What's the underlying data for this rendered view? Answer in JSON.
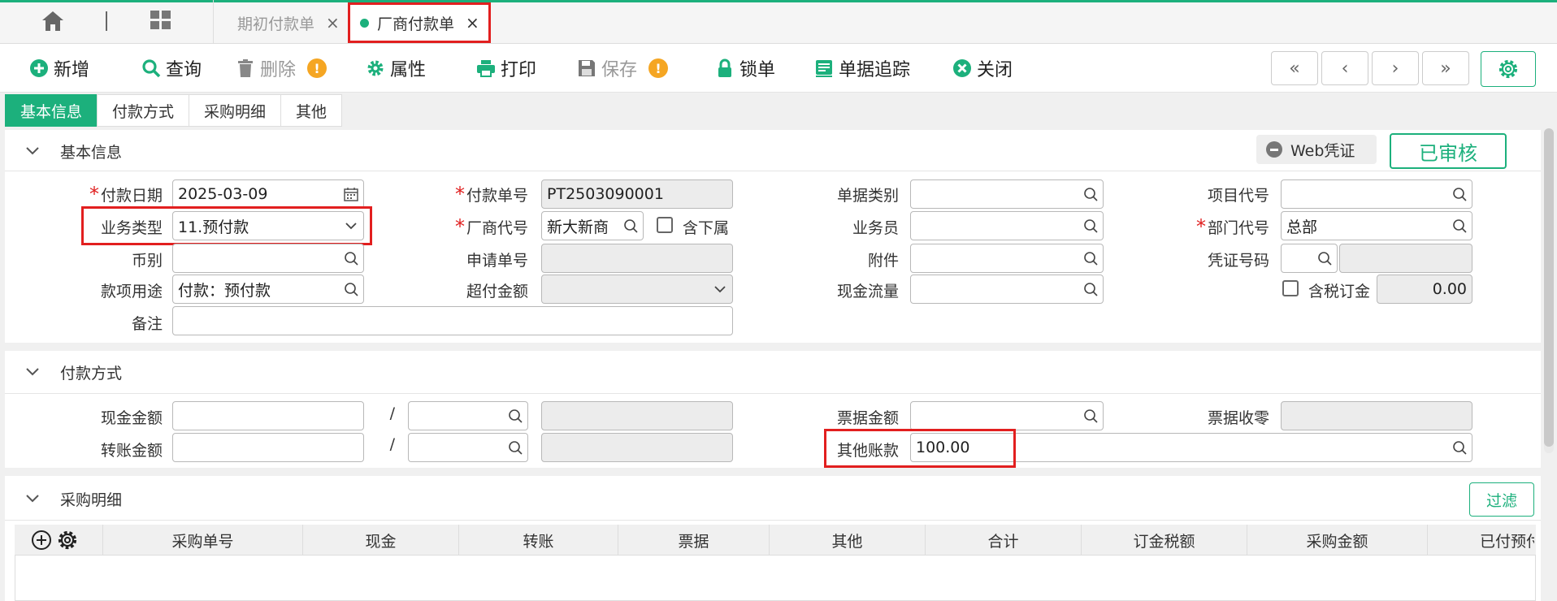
{
  "tabs": {
    "tab1": "期初付款单",
    "tab2": "厂商付款单",
    "close": "×"
  },
  "toolbar": {
    "add": "新增",
    "query": "查询",
    "delete": "删除",
    "properties": "属性",
    "print": "打印",
    "save": "保存",
    "lock": "锁单",
    "trace": "单据追踪",
    "close": "关闭",
    "warn": "!",
    "first": "«",
    "prev": "‹",
    "next": "›",
    "last": "»"
  },
  "section_tabs": [
    "基本信息",
    "付款方式",
    "采购明细",
    "其他"
  ],
  "basic": {
    "title": "基本信息",
    "web_voucher": "Web凭证",
    "status": "已审核",
    "pay_date_label": "付款日期",
    "pay_date_value": "2025-03-09",
    "biz_type_label": "业务类型",
    "biz_type_value": "11.预付款",
    "currency_label": "币别",
    "currency_value": "",
    "purpose_label": "款项用途",
    "purpose_value": "付款：预付款",
    "remark_label": "备注",
    "remark_value": "",
    "pay_no_label": "付款单号",
    "pay_no_value": "PT2503090001",
    "vendor_label": "厂商代号",
    "vendor_value": "新大新商",
    "include_sub_label": "含下属",
    "apply_no_label": "申请单号",
    "apply_no_value": "",
    "overpay_label": "超付金额",
    "overpay_value": "",
    "doc_type_label": "单据类别",
    "salesman_label": "业务员",
    "attach_label": "附件",
    "cashflow_label": "现金流量",
    "project_label": "项目代号",
    "dept_label": "部门代号",
    "dept_value": "总部",
    "voucher_no_label": "凭证号码",
    "tax_order_label": "含税订金",
    "tax_order_value": "0.00"
  },
  "payment": {
    "title": "付款方式",
    "cash_label": "现金金额",
    "transfer_label": "转账金额",
    "slash": "/",
    "bill_amount_label": "票据金额",
    "bill_receipt_label": "票据收零",
    "other_label": "其他账款",
    "other_value": "100.00"
  },
  "purchase": {
    "title": "采购明细",
    "filter": "过滤",
    "columns": [
      "采购单号",
      "现金",
      "转账",
      "票据",
      "其他",
      "合计",
      "订金税额",
      "采购金额",
      "已付预付"
    ]
  }
}
